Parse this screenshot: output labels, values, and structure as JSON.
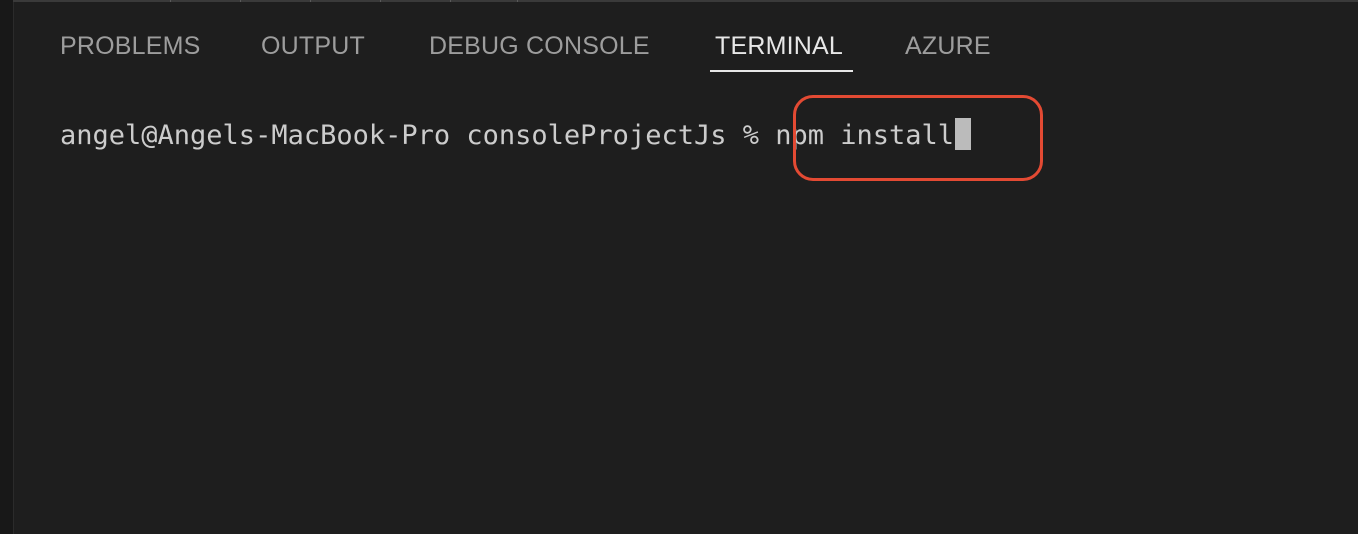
{
  "panel": {
    "tabs": [
      {
        "label": "PROBLEMS",
        "active": false
      },
      {
        "label": "OUTPUT",
        "active": false
      },
      {
        "label": "DEBUG CONSOLE",
        "active": false
      },
      {
        "label": "TERMINAL",
        "active": true
      },
      {
        "label": "AZURE",
        "active": false
      }
    ]
  },
  "terminal": {
    "prompt": "angel@Angels-MacBook-Pro consoleProjectJs % ",
    "command": "npm install"
  },
  "colors": {
    "background": "#1e1e1e",
    "tab_inactive": "#9d9d9d",
    "tab_active": "#e7e7e7",
    "terminal_text": "#cccccc",
    "highlight_border": "#e34a33"
  },
  "icons": {
    "cursor": "text-cursor-block"
  }
}
